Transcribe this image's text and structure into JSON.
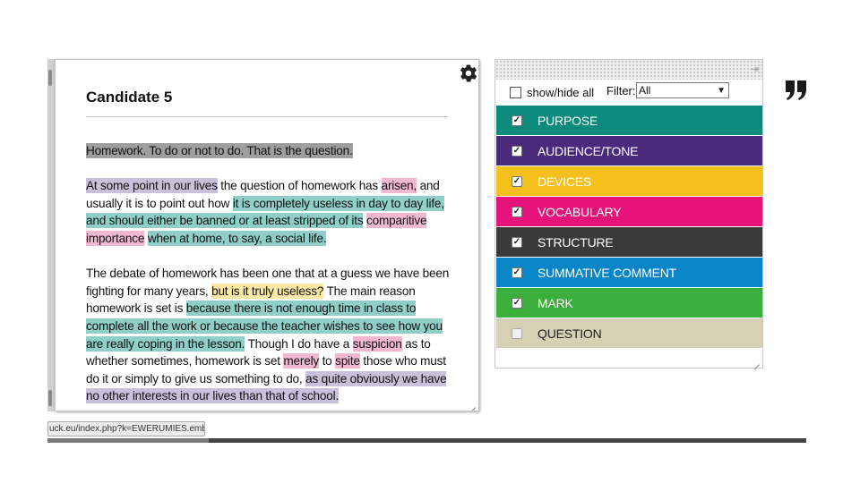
{
  "document": {
    "title": "Candidate 5",
    "paragraphs": [
      [
        {
          "text": "Homework. To do or not to do. That is the question.",
          "category": "purpose"
        }
      ],
      [
        {
          "text": "At some point in our lives",
          "category": "audience"
        },
        {
          "text": " the question of homework has ",
          "category": ""
        },
        {
          "text": "arisen,",
          "category": "vocab"
        },
        {
          "text": " and usually it is to point out how ",
          "category": ""
        },
        {
          "text": "it is completely useless in day to day life, and should either be banned or at least stripped of its",
          "category": "summative"
        },
        {
          "text": " ",
          "category": ""
        },
        {
          "text": "comparitive importance",
          "category": "vocab"
        },
        {
          "text": " ",
          "category": ""
        },
        {
          "text": "when at home, to say, a social life.",
          "category": "summative"
        }
      ],
      [
        {
          "text": "The debate of homework has been one that at a guess we have been fighting for many years, ",
          "category": ""
        },
        {
          "text": "but is it truly useless?",
          "category": "devices"
        },
        {
          "text": " The main reason homework is set is ",
          "category": ""
        },
        {
          "text": "because there is not enough time in class to complete all the work or because the teacher wishes to see how you are really coping in the lesson.",
          "category": "summative"
        },
        {
          "text": " Though I do have a ",
          "category": ""
        },
        {
          "text": "suspicion",
          "category": "vocab"
        },
        {
          "text": " as to whether sometimes, homework is set ",
          "category": ""
        },
        {
          "text": "merely",
          "category": "vocab"
        },
        {
          "text": " to ",
          "category": ""
        },
        {
          "text": "spite",
          "category": "vocab"
        },
        {
          "text": " those who must do it or simply to give us something to do, ",
          "category": ""
        },
        {
          "text": "as quite obviously we have no other interests in our lives than that of school.",
          "category": "audience"
        }
      ]
    ]
  },
  "status_url": "uck.eu/index.php?k=EWERUMIES.embed=1#",
  "filter": {
    "show_hide_label": "show/hide all",
    "filter_label": "Filter:",
    "filter_value": "All",
    "categories": [
      {
        "name": "PURPOSE",
        "color": "#0e8a7d",
        "text_color": "#ffffff",
        "checked": true
      },
      {
        "name": "AUDIENCE/TONE",
        "color": "#4a2a7a",
        "text_color": "#ffffff",
        "checked": true
      },
      {
        "name": "DEVICES",
        "color": "#f5bf1d",
        "text_color": "#ffffff",
        "checked": true
      },
      {
        "name": "VOCABULARY",
        "color": "#e6147a",
        "text_color": "#ffffff",
        "checked": true
      },
      {
        "name": "STRUCTURE",
        "color": "#3a3a3a",
        "text_color": "#ffffff",
        "checked": true
      },
      {
        "name": "SUMMATIVE COMMENT",
        "color": "#0a86c8",
        "text_color": "#ffffff",
        "checked": true
      },
      {
        "name": "MARK",
        "color": "#3cae3c",
        "text_color": "#ffffff",
        "checked": true
      },
      {
        "name": "QUESTION",
        "color": "#d6d1b4",
        "text_color": "#222222",
        "checked": false
      }
    ]
  },
  "icons": {
    "settings": "gear-icon",
    "quote": "quote-icon"
  }
}
